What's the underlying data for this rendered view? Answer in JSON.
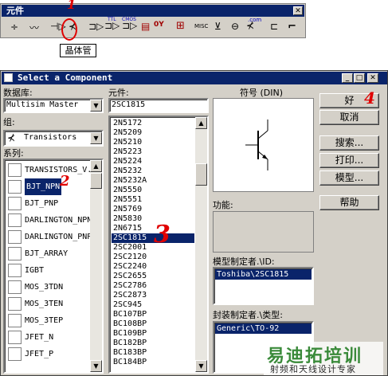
{
  "toolbar": {
    "title": "元件",
    "tooltip": "晶体管",
    "icons": [
      "ground-source",
      "resistor",
      "diode",
      "transistor",
      "analog",
      "ttl",
      "cmos",
      "mcu",
      "advanced-peripheral",
      "misc-digital",
      "mixed",
      "indicator",
      "power",
      "misc",
      "rf",
      "electromech",
      "ladder",
      "connector"
    ],
    "misc_label": "MISC",
    "com_label": ".com",
    "ttl_label": "TTL",
    "cmos_label": "CMOS",
    "overlay_number": "1"
  },
  "dialog": {
    "title": "Select a Component",
    "database_label": "数据库:",
    "database_value": "Multisim Master",
    "group_label": "组:",
    "group_value": "Transistors",
    "family_label": "系列:",
    "families": [
      "TRANSISTORS_V.",
      "BJT_NPN",
      "BJT_PNP",
      "DARLINGTON_NPN",
      "DARLINGTON_PNP",
      "BJT_ARRAY",
      "IGBT",
      "MOS_3TDN",
      "MOS_3TEN",
      "MOS_3TEP",
      "JFET_N",
      "JFET_P"
    ],
    "selected_family_index": 1,
    "component_label": "元件:",
    "component_value": "2SC1815",
    "components": [
      "2N5172",
      "2N5209",
      "2N5210",
      "2N5223",
      "2N5224",
      "2N5232",
      "2N5232A",
      "2N5550",
      "2N5551",
      "2N5769",
      "2N5830",
      "2N6715",
      "2SC1815",
      "2SC2001",
      "2SC2120",
      "2SC2240",
      "2SC2655",
      "2SC2786",
      "2SC2873",
      "2SC945",
      "BC107BP",
      "BC108BP",
      "BC109BP",
      "BC182BP",
      "BC183BP",
      "BC184BP"
    ],
    "selected_component_index": 12,
    "symbol_label": "符号 (DIN)",
    "function_label": "功能:",
    "model_label": "模型制定者.\\ID:",
    "model_value": "Toshiba\\2SC1815",
    "footprint_label": "封装制定者.\\类型:",
    "footprint_value": "Generic\\TO-92",
    "buttons": {
      "ok": "好",
      "cancel": "取消",
      "search": "搜索...",
      "print": "打印...",
      "model": "模型...",
      "help": "帮助"
    },
    "annotations": {
      "n2": "2",
      "n3": "3",
      "n4": "4"
    }
  },
  "watermark": {
    "main": "易迪拓培训",
    "sub": "射频和天线设计专家"
  }
}
